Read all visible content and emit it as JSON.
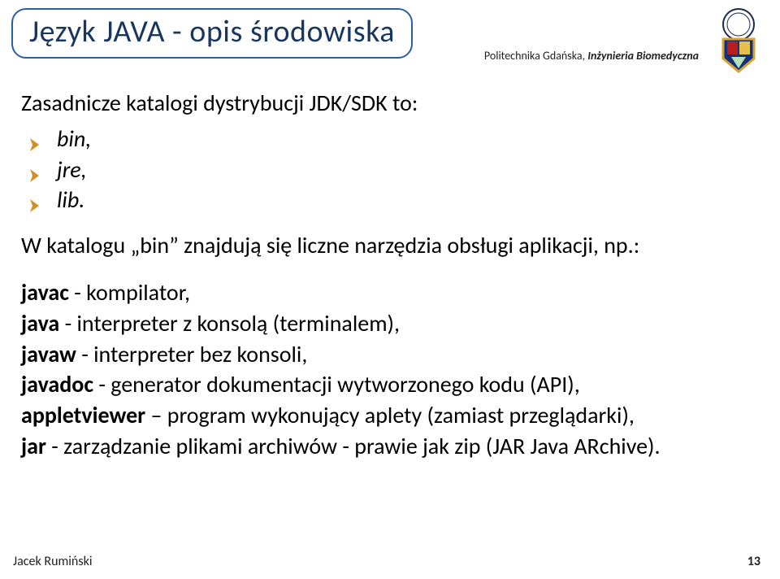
{
  "title": "Język JAVA - opis środowiska",
  "affiliation": {
    "org": "Politechnika Gdańska, ",
    "dept": "Inżynieria Biomedyczna"
  },
  "intro": "Zasadnicze katalogi dystrybucji JDK/SDK to:",
  "catalogs": [
    "bin,",
    "jre,",
    "lib."
  ],
  "para2": "W katalogu „bin” znajdują się liczne narzędzia obsługi aplikacji, np.:",
  "tools": [
    {
      "name": "javac",
      "desc": " - kompilator,"
    },
    {
      "name": "java",
      "desc": " - interpreter z konsolą  (terminalem),"
    },
    {
      "name": "javaw",
      "desc": " - interpreter bez konsoli,"
    },
    {
      "name": "javadoc",
      "desc": " -  generator dokumentacji wytworzonego kodu (API),"
    },
    {
      "name": "appletviewer",
      "desc": " – program wykonujący aplety (zamiast przeglądarki),"
    },
    {
      "name": "jar",
      "desc": " - zarządzanie plikami archiwów  - prawie jak zip (JAR Java ARchive)."
    }
  ],
  "footer": {
    "author": "Jacek Rumiński",
    "page": "13"
  }
}
